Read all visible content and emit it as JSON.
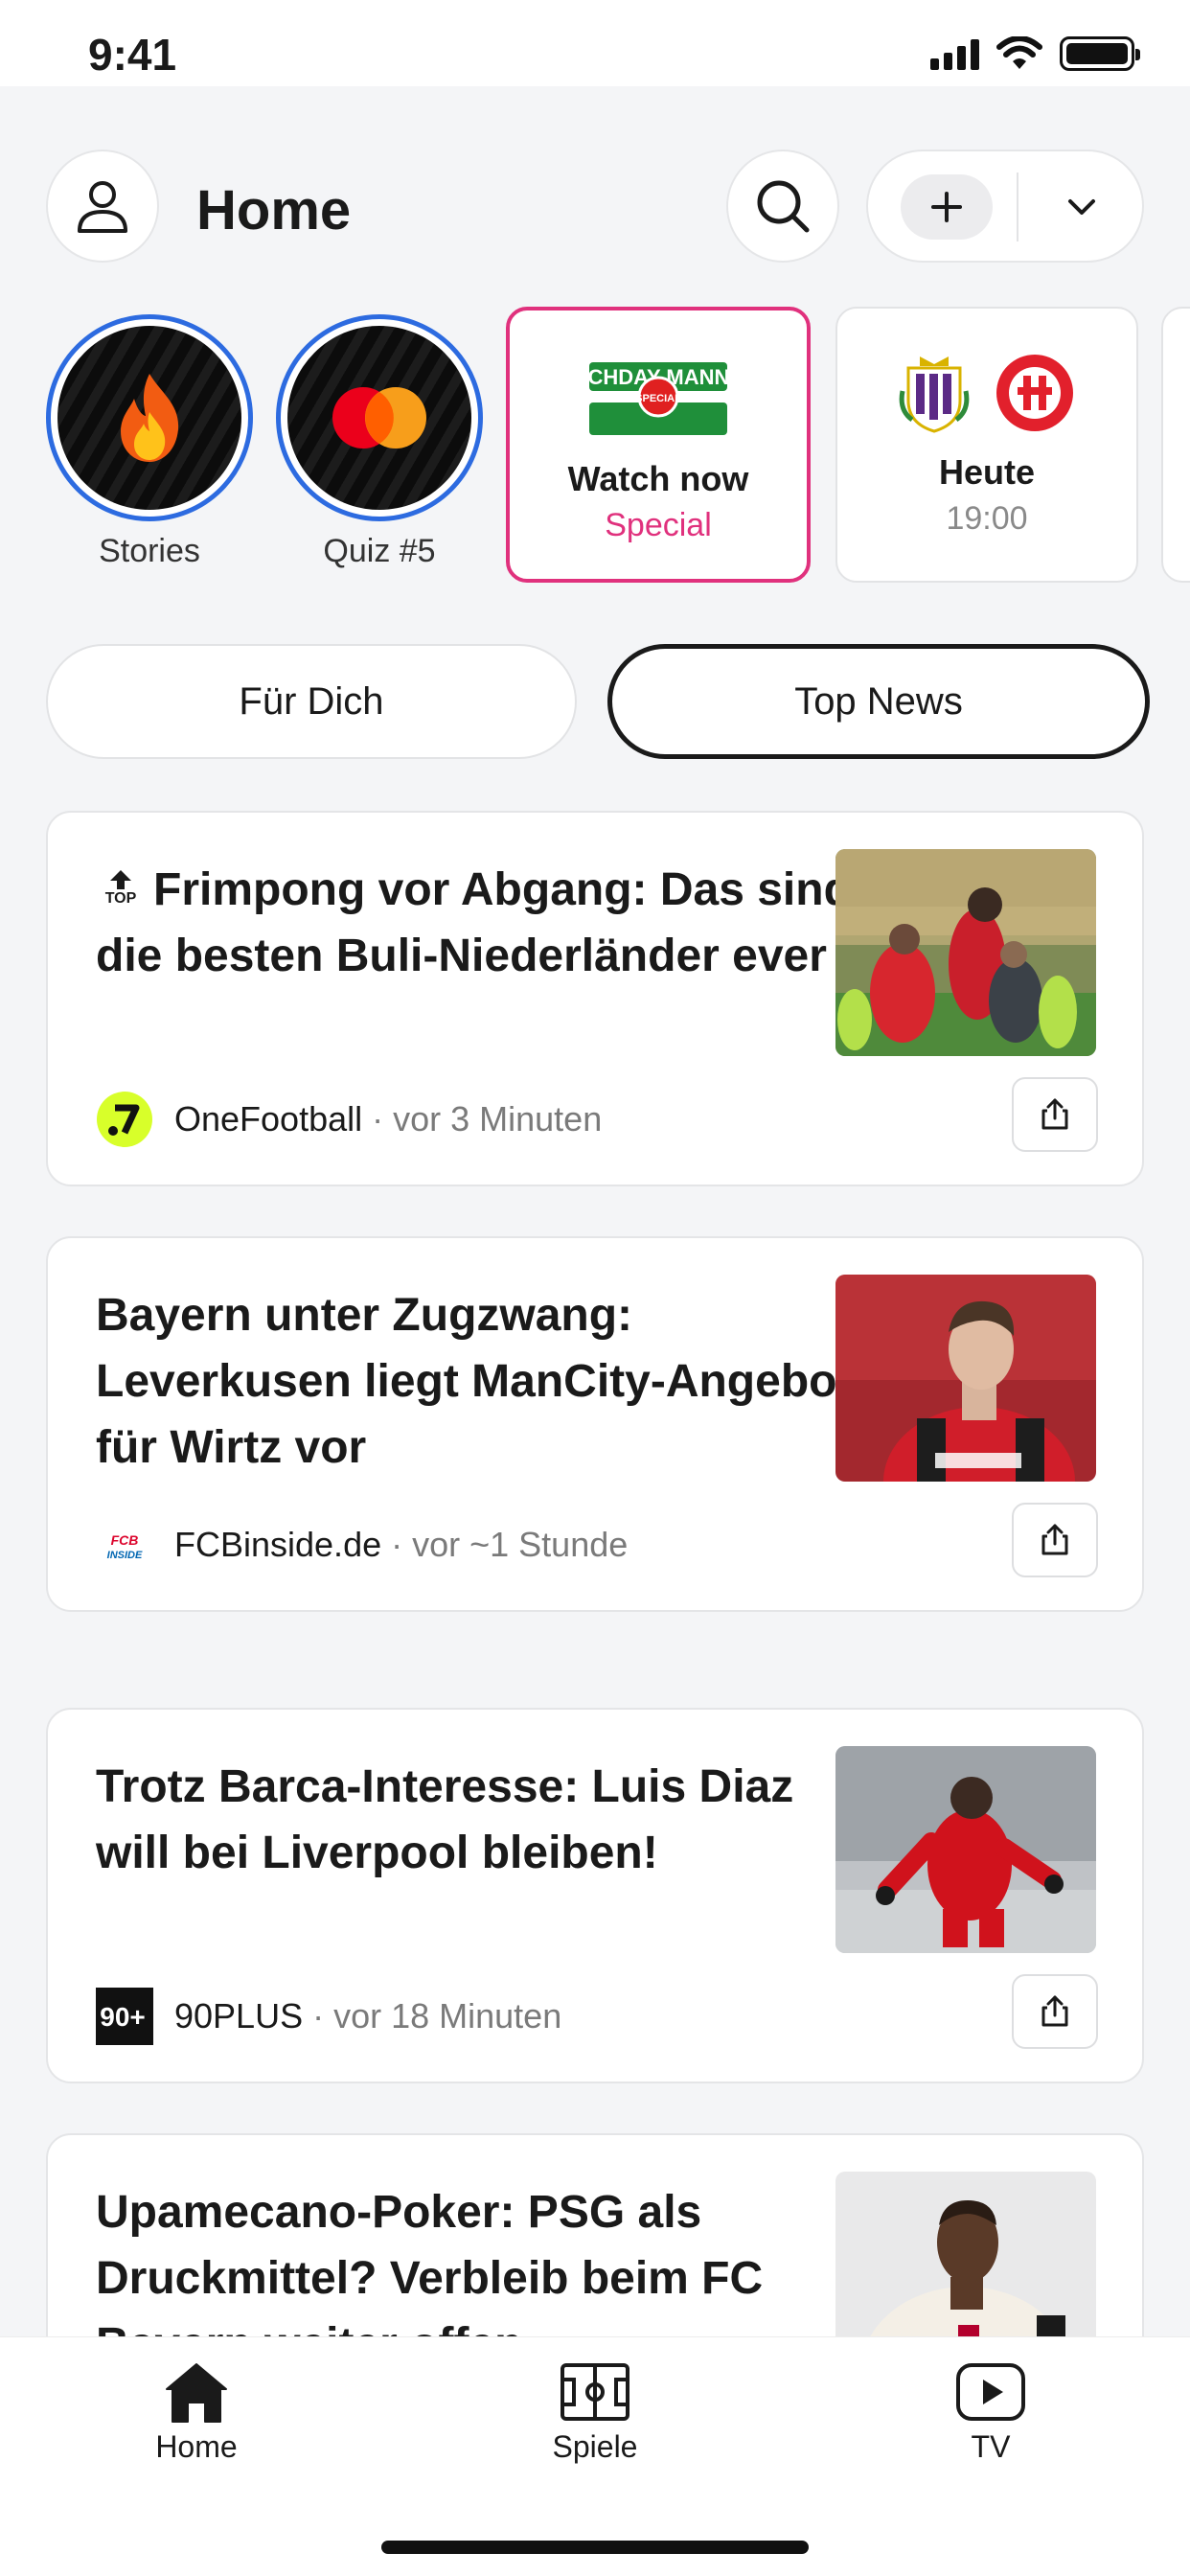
{
  "status_bar": {
    "time": "9:41"
  },
  "header": {
    "title": "Home"
  },
  "stories": [
    {
      "label": "Stories",
      "icon": "fire-icon"
    },
    {
      "label": "Quiz #5",
      "icon": "mastercard-logo"
    }
  ],
  "promo_cards": [
    {
      "logo_text": "MATCHDAY MANNERS",
      "badge": "SPECIAL",
      "title": "Watch now",
      "subtitle": "Special",
      "accent": "#e0317d"
    },
    {
      "title": "Heute",
      "subtitle": "19:00"
    }
  ],
  "tabs": [
    {
      "label": "Für Dich",
      "selected": false
    },
    {
      "label": "Top News",
      "selected": true
    }
  ],
  "articles": [
    {
      "badge": "TOP",
      "title": "Frimpong vor Abgang: Das sind die besten Buli-Niederländer ever",
      "source": "OneFootball",
      "time": "· vor 3 Minuten"
    },
    {
      "title": "Bayern unter Zugzwang: Leverkusen liegt ManCity-Angebot für Wirtz vor",
      "source": "FCBinside.de",
      "time": "· vor ~1 Stunde",
      "logo_text": "FCB INSIDE"
    },
    {
      "title": "Trotz Barca-Interesse: Luis Diaz will bei Liverpool bleiben!",
      "source": "90PLUS",
      "time": "· vor 18 Minuten",
      "logo_text": "90+"
    },
    {
      "title": "Upamecano-Poker: PSG als Druckmittel? Verbleib beim FC Bayern weiter offen",
      "source": "",
      "time": ""
    }
  ],
  "bottom_nav": [
    {
      "label": "Home",
      "icon": "home-icon"
    },
    {
      "label": "Spiele",
      "icon": "pitch-icon"
    },
    {
      "label": "TV",
      "icon": "play-icon"
    }
  ]
}
